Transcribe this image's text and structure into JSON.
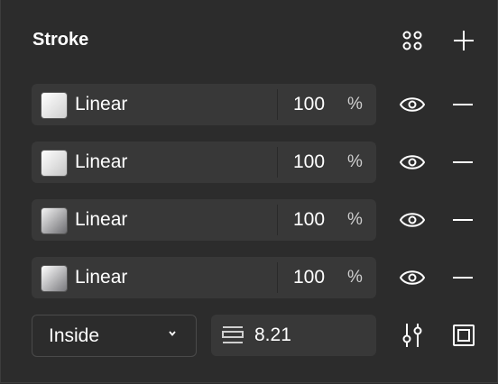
{
  "panel": {
    "title": "Stroke",
    "icons": {
      "styles": "grid-dots-icon",
      "add": "plus-icon"
    }
  },
  "fills": [
    {
      "type": "Linear",
      "opacity": "100",
      "unit": "%",
      "swatch": "linear-gradient(135deg,#ffffff 0%,#cfcfcf 100%)"
    },
    {
      "type": "Linear",
      "opacity": "100",
      "unit": "%",
      "swatch": "linear-gradient(135deg,#ffffff 0%,#c6c6c6 100%)"
    },
    {
      "type": "Linear",
      "opacity": "100",
      "unit": "%",
      "swatch": "linear-gradient(135deg,#f4f4f4 0%,#6e6e72 100%)"
    },
    {
      "type": "Linear",
      "opacity": "100",
      "unit": "%",
      "swatch": "linear-gradient(135deg,#ffffff 0%,#7a7a7e 100%)"
    }
  ],
  "stroke": {
    "position": "Inside",
    "weight": "8.21"
  },
  "colors": {
    "panel_bg": "#2c2c2c",
    "field_bg": "#383838",
    "text": "#ffffff"
  }
}
